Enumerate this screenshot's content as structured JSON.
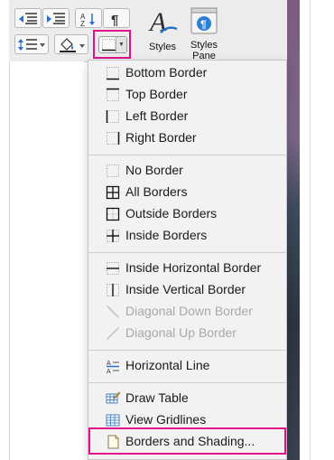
{
  "ribbon": {
    "styles_label": "Styles",
    "styles_pane_label_1": "Styles",
    "styles_pane_label_2": "Pane"
  },
  "colors": {
    "highlight": "#e0118b",
    "menu_bg": "#f2f2f2",
    "disabled_text": "#a8a8a8"
  },
  "menu": {
    "items": [
      {
        "label": "Bottom Border",
        "icon": "bottom-border-icon"
      },
      {
        "label": "Top Border",
        "icon": "top-border-icon"
      },
      {
        "label": "Left Border",
        "icon": "left-border-icon"
      },
      {
        "label": "Right Border",
        "icon": "right-border-icon"
      },
      {
        "label": "No Border",
        "icon": "no-border-icon"
      },
      {
        "label": "All Borders",
        "icon": "all-borders-icon"
      },
      {
        "label": "Outside Borders",
        "icon": "outside-borders-icon"
      },
      {
        "label": "Inside Borders",
        "icon": "inside-borders-icon"
      },
      {
        "label": "Inside Horizontal Border",
        "icon": "inside-horizontal-border-icon"
      },
      {
        "label": "Inside Vertical Border",
        "icon": "inside-vertical-border-icon"
      },
      {
        "label": "Diagonal Down Border",
        "icon": "diagonal-down-border-icon",
        "disabled": true
      },
      {
        "label": "Diagonal Up Border",
        "icon": "diagonal-up-border-icon",
        "disabled": true
      },
      {
        "label": "Horizontal Line",
        "icon": "horizontal-line-icon"
      },
      {
        "label": "Draw Table",
        "icon": "draw-table-icon"
      },
      {
        "label": "View Gridlines",
        "icon": "view-gridlines-icon"
      },
      {
        "label": "Borders and Shading...",
        "icon": "borders-and-shading-icon",
        "highlighted": true
      }
    ]
  }
}
